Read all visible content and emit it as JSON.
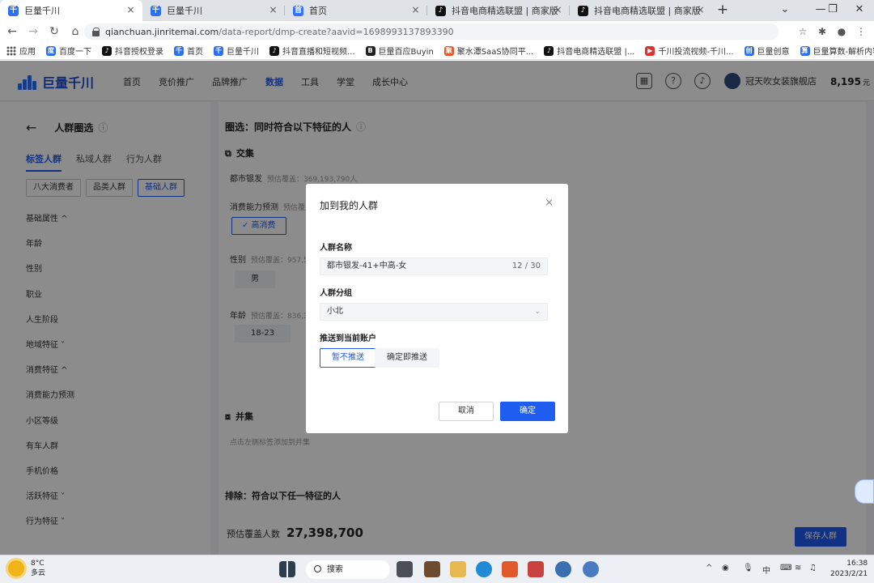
{
  "browser": {
    "tabs": [
      {
        "label": "巨量千川",
        "icon": "jl",
        "active": true
      },
      {
        "label": "巨量千川",
        "icon": "jl",
        "active": false
      },
      {
        "label": "首页",
        "icon": "bd",
        "active": false
      },
      {
        "label": "抖音电商精选联盟 | 商家版",
        "icon": "tk",
        "active": false
      },
      {
        "label": "抖音电商精选联盟 | 商家版",
        "icon": "tk",
        "active": false
      }
    ],
    "url_host": "qianchuan.jinritemai.com",
    "url_path": "/data-report/dmp-create?aavid=1698993137893390",
    "bookmarks": [
      {
        "label": "应用",
        "icon": "apps-grid-icon"
      },
      {
        "label": "百度一下",
        "color": "#2e6ff1"
      },
      {
        "label": "抖音授权登录",
        "color": "#111111"
      },
      {
        "label": "首页",
        "color": "#2e6ff1"
      },
      {
        "label": "巨量千川",
        "color": "#2e6ff1"
      },
      {
        "label": "抖音直播和短视频...",
        "color": "#111111"
      },
      {
        "label": "巨量百应Buyin",
        "color": "#222222"
      },
      {
        "label": "聚水潭SaaS协同平...",
        "color": "#e05a2b"
      },
      {
        "label": "抖音电商精选联盟 |...",
        "color": "#111111"
      },
      {
        "label": "千川投流视频-千川...",
        "color": "#d33"
      },
      {
        "label": "巨量创意",
        "color": "#2e6ff1"
      },
      {
        "label": "巨量算数-解析内容...",
        "color": "#2e6ff1"
      }
    ]
  },
  "app": {
    "logo": "巨量千川",
    "menu": [
      "首页",
      "竞价推广",
      "品牌推广",
      "数据",
      "工具",
      "学堂",
      "成长中心"
    ],
    "menu_active": 3,
    "account": "冠天吹女装旗舰店",
    "balance": "8,195",
    "balance_unit": "元",
    "sidebar": {
      "title": "人群圈选",
      "tabs": [
        "标签人群",
        "私域人群",
        "行为人群"
      ],
      "chips": [
        "八大消费者",
        "品类人群",
        "基础人群"
      ],
      "items": [
        "基础属性 ^",
        "年龄",
        "性别",
        "职业",
        "人生阶段",
        "地域特征 ˅",
        "消费特征 ^",
        "消费能力预测",
        "小区等级",
        "有车人群",
        "手机价格",
        "活跃特征 ˅",
        "行为特征 ˅"
      ]
    },
    "main": {
      "title": "圈选：同时符合以下特征的人",
      "intersect": "交集",
      "r1_label": "都市银发",
      "r1_hint": "预估覆盖：369,193,790人",
      "r2_label": "消费能力预测",
      "r2_hint": "预估覆盖：",
      "r2_option": "✓ 高消费",
      "r3_label": "性别",
      "r3_hint": "预估覆盖：957,57...",
      "r3_option": "男",
      "r4_label": "年龄",
      "r4_hint": "预估覆盖：836,39...",
      "r4_option": "18-23",
      "union": "并集",
      "union_hint": "点击左侧标签添加到并集",
      "exclude": "排除：符合以下任一特征的人",
      "estimate_label": "预估覆盖人数",
      "estimate_value": "27,398,700",
      "save_btn": "保存人群"
    }
  },
  "modal": {
    "title": "加到我的人群",
    "name_label": "人群名称",
    "name_value": "都市银发-41+中高-女",
    "name_count": "12 / 30",
    "group_label": "人群分组",
    "group_value": "小北",
    "push_label": "推送到当前账户",
    "push_options": [
      "暂不推送",
      "确定即推送"
    ],
    "push_selected": 0,
    "cancel": "取消",
    "confirm": "确定"
  },
  "taskbar": {
    "temp": "8°C",
    "weather": "多云",
    "search": "搜索",
    "ime": "中",
    "time": "16:38",
    "date": "2023/2/21"
  }
}
